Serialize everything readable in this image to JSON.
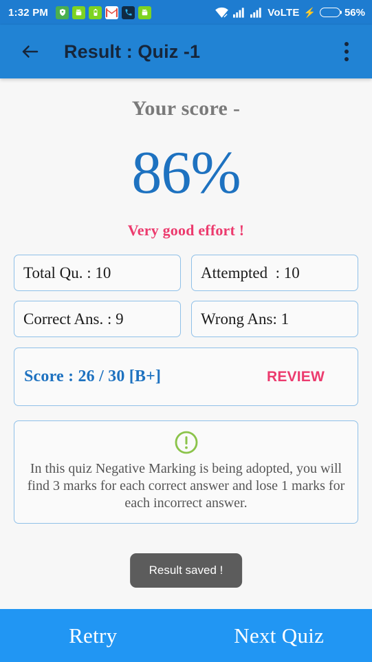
{
  "status_bar": {
    "time": "1:32 PM",
    "notification_icons": [
      {
        "name": "location-shield-icon",
        "glyph": "◉"
      },
      {
        "name": "android-robot-icon",
        "glyph": "◑"
      },
      {
        "name": "battery-saver-icon",
        "glyph": "▯"
      },
      {
        "name": "gmail-icon",
        "glyph": "M"
      },
      {
        "name": "phone-call-icon",
        "glyph": "✆"
      },
      {
        "name": "android-robot-icon-2",
        "glyph": "◑"
      }
    ],
    "wifi_icon": "wifi-off-icon",
    "signal_icon_1": "signal-bars-icon",
    "signal_icon_2": "signal-bars-icon",
    "network_label": "VoLTE",
    "charging_icon": "⚡",
    "battery_percent": "56%",
    "battery_level": 56
  },
  "app_bar": {
    "back_icon": "back-arrow-icon",
    "title": "Result : Quiz -1",
    "overflow_icon": "more-vertical-icon"
  },
  "result": {
    "score_label": "Your score -",
    "score_percent": "86%",
    "effort_message": "Very good effort !",
    "stats": [
      {
        "name": "total-questions",
        "text": "Total Qu. : 10"
      },
      {
        "name": "attempted",
        "text": "Attempted  : 10"
      },
      {
        "name": "correct-answers",
        "text": "Correct Ans. : 9"
      },
      {
        "name": "wrong-answers",
        "text": "Wrong Ans: 1"
      }
    ],
    "score_card": {
      "score_text": "Score : 26 / 30 [B+]",
      "review_label": "REVIEW"
    },
    "info": {
      "icon": "alert-circle-icon",
      "text": "In this quiz Negative Marking is being adopted, you will find 3 marks for each correct answer and lose 1 marks for each incorrect answer."
    }
  },
  "toast": {
    "message": "Result saved !"
  },
  "bottom_bar": {
    "retry_label": "Retry",
    "next_label": "Next Quiz"
  },
  "colors": {
    "status_bar_blue": "#1e7cd0",
    "app_bar_blue": "#2183d4",
    "bottom_bar_blue": "#2196f3",
    "score_blue": "#1e72c0",
    "accent_pink": "#ec3b6e",
    "info_green": "#8bc34a",
    "card_border": "#8fc0e8",
    "page_background": "#f7f7f7",
    "toast_background": "#5c5c5c"
  }
}
